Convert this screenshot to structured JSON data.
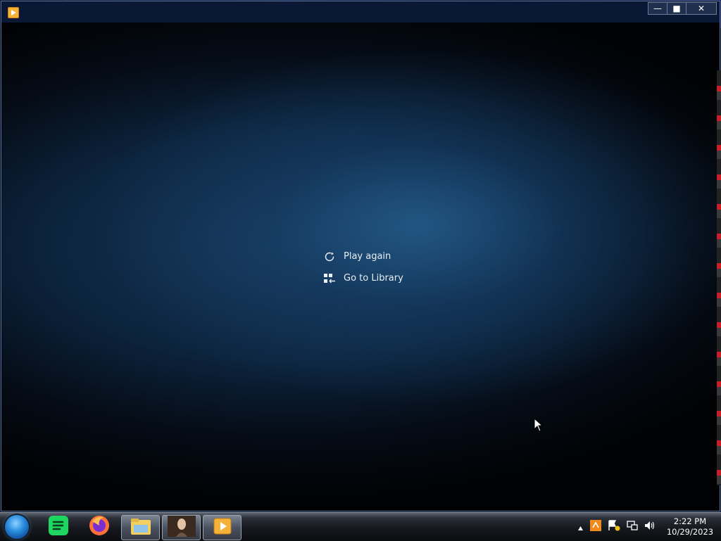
{
  "end_screen": {
    "play_again": "Play again",
    "go_to_library": "Go to Library"
  },
  "window_controls": {
    "minimize": "—",
    "maximize": "■",
    "close": "✕"
  },
  "clock": {
    "time": "2:22 PM",
    "date": "10/29/2023"
  },
  "taskbar": {
    "pinned": [
      "spotify",
      "firefox",
      "file-explorer",
      "photo-viewer",
      "media-player"
    ]
  },
  "colors": {
    "accent": "#2a8ee0",
    "spotify": "#1ed760",
    "firefox": "#ff7139",
    "media_player": "#f4b23a"
  }
}
